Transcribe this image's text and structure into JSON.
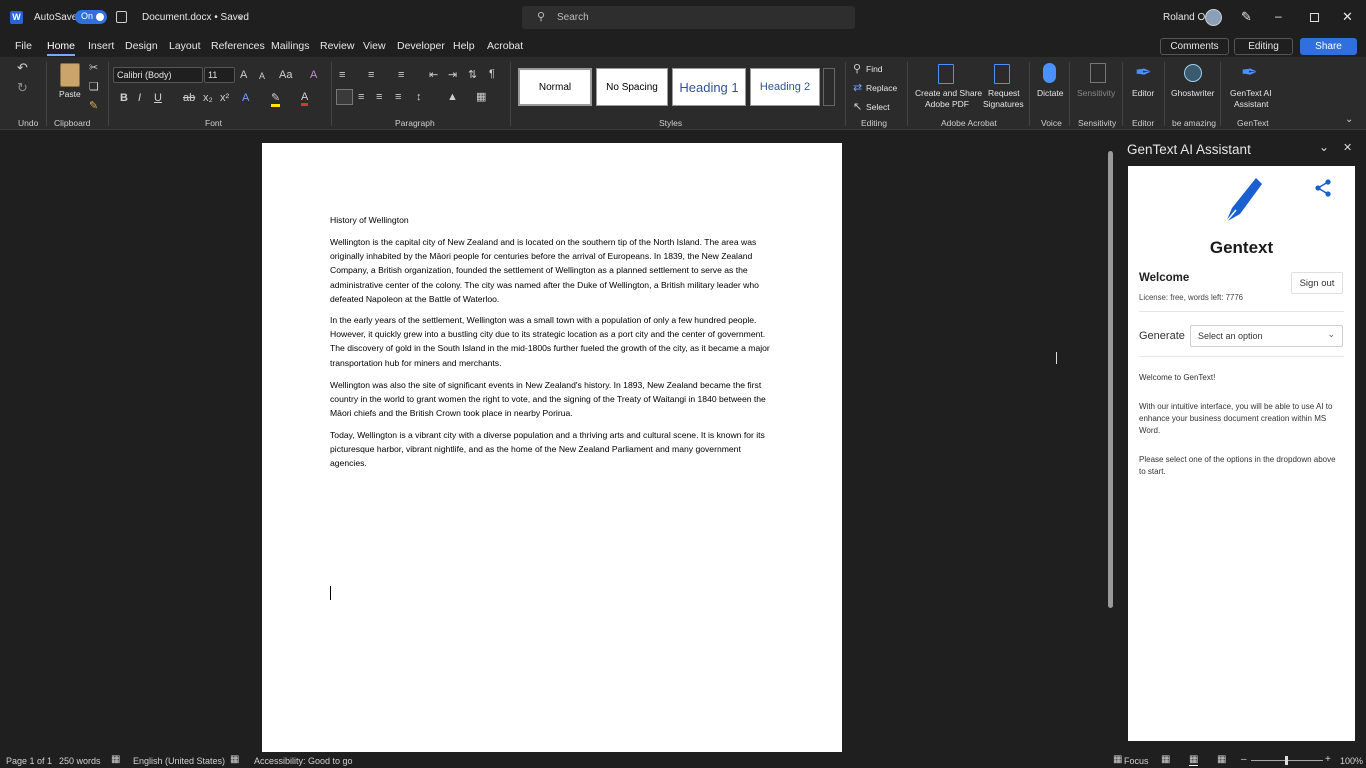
{
  "titlebar": {
    "autosave_label": "AutoSave",
    "autosave_state": "On",
    "doc_name": "Document.docx • Saved",
    "search_placeholder": "Search",
    "user_name": "Roland O"
  },
  "menu": [
    "File",
    "Home",
    "Insert",
    "Design",
    "Layout",
    "References",
    "Mailings",
    "Review",
    "View",
    "Developer",
    "Help",
    "Acrobat"
  ],
  "menu_active": "Home",
  "actions": {
    "comments": "Comments",
    "editing": "Editing",
    "share": "Share"
  },
  "ribbon": {
    "font_name": "Calibri (Body)",
    "font_size": "11",
    "paste": "Paste",
    "styles": [
      "Normal",
      "No Spacing",
      "Heading 1",
      "Heading 2"
    ],
    "find": "Find",
    "replace": "Replace",
    "select": "Select",
    "buttons": {
      "create_share_1": "Create and Share",
      "create_share_2": "Adobe PDF",
      "request_1": "Request",
      "request_2": "Signatures",
      "dictate": "Dictate",
      "sensitivity": "Sensitivity",
      "editor": "Editor",
      "ghostwriter": "Ghostwriter",
      "gentext_1": "GenText AI",
      "gentext_2": "Assistant"
    },
    "groups": {
      "undo": "Undo",
      "clipboard": "Clipboard",
      "font": "Font",
      "paragraph": "Paragraph",
      "styles": "Styles",
      "editing": "Editing",
      "acrobat": "Adobe Acrobat",
      "voice": "Voice",
      "sensitivity": "Sensitivity",
      "editor": "Editor",
      "be_amazing": "be amazing",
      "gentext": "GenText"
    }
  },
  "document": {
    "title": "History of Wellington",
    "paragraphs": [
      "Wellington is the capital city of New Zealand and is located on the southern tip of the North Island. The area was originally inhabited by the Māori people for centuries before the arrival of Europeans. In 1839, the New Zealand Company, a British organization, founded the settlement of Wellington as a planned settlement to serve as the administrative center of the colony. The city was named after the Duke of Wellington, a British military leader who defeated Napoleon at the Battle of Waterloo.",
      "In the early years of the settlement, Wellington was a small town with a population of only a few hundred people. However, it quickly grew into a bustling city due to its strategic location as a port city and the center of government. The discovery of gold in the South Island in the mid-1800s further fueled the growth of the city, as it became a major transportation hub for miners and merchants.",
      "Wellington was also the site of significant events in New Zealand's history. In 1893, New Zealand became the first country in the world to grant women the right to vote, and the signing of the Treaty of Waitangi in 1840 between the Māori chiefs and the British Crown took place in nearby Porirua.",
      "Today, Wellington is a vibrant city with a diverse population and a thriving arts and cultural scene. It is known for its picturesque harbor, vibrant nightlife, and as the home of the New Zealand Parliament and many government agencies."
    ]
  },
  "pane": {
    "header": "GenText AI Assistant",
    "brand": "Gentext",
    "welcome": "Welcome",
    "sign_out": "Sign out",
    "license": "License: free, words left: 7776",
    "generate_label": "Generate",
    "select_placeholder": "Select an option",
    "msg1": "Welcome to GenText!",
    "msg2": "With our intuitive interface, you will be able to use AI to enhance your business document creation within MS Word.",
    "msg3": "Please select one of the options in the dropdown above to start."
  },
  "status": {
    "page": "Page 1 of 1",
    "words": "250 words",
    "language": "English (United States)",
    "accessibility": "Accessibility: Good to go",
    "focus": "Focus",
    "zoom": "100%"
  },
  "colors": {
    "accent": "#1a5fd0",
    "share": "#2f6fde"
  }
}
